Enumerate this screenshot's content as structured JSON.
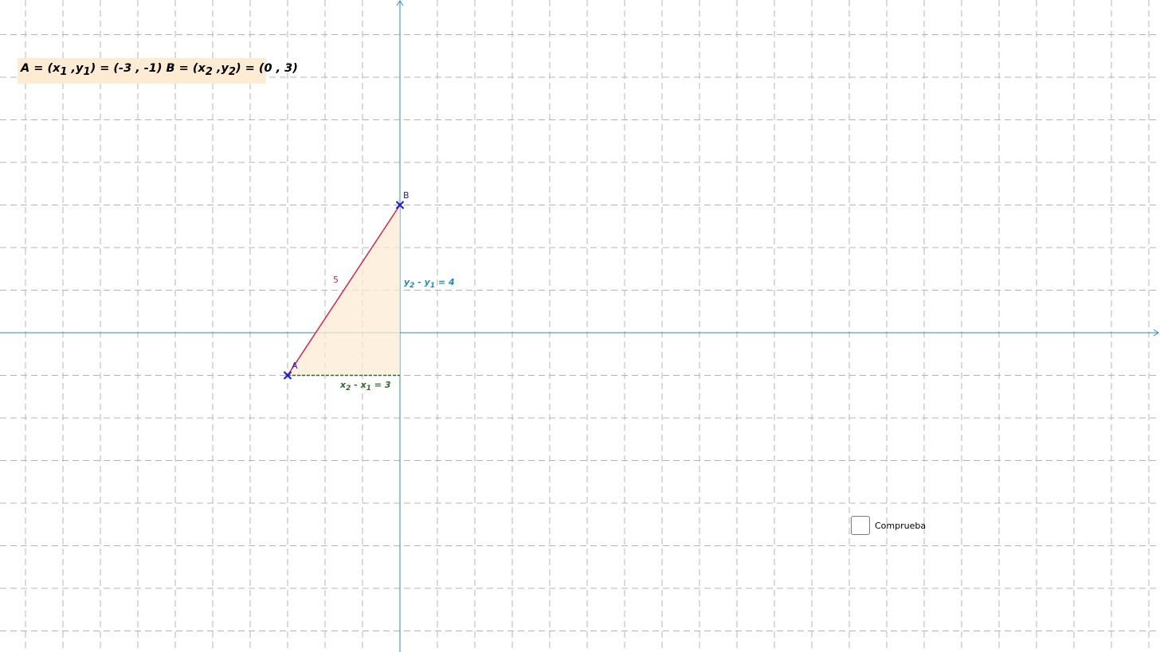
{
  "coords": {
    "a_prefix": "A = (x",
    "a_sub1": "1",
    "a_mid": " ,y",
    "a_sub2": "1",
    "a_value": ") = (-3 , -1)  B = (x",
    "b_sub1": "2",
    "b_mid": " ,y",
    "b_sub2": "2",
    "b_value": ") = (0 , 3)"
  },
  "points": {
    "A": {
      "label": "A",
      "x": -3,
      "y": -1
    },
    "B": {
      "label": "B",
      "x": 0,
      "y": 3
    }
  },
  "segment_label": "5",
  "dy_label": {
    "a": "y",
    "s1": "2",
    "b": " - y",
    "s2": "1",
    "c": " = 4"
  },
  "dx_label": {
    "a": "x",
    "s1": "2",
    "b": " - x",
    "s2": "1",
    "c": " = 3"
  },
  "checkbox": {
    "label": "Comprueba",
    "checked": false
  },
  "colors": {
    "grid": "#b4b4b4",
    "axis": "#2c8ac7",
    "segment": "#d6244a",
    "triangle_fill": "#fdebd3",
    "point": "#1a1acc",
    "dx_line": "#2f6b2f"
  }
}
